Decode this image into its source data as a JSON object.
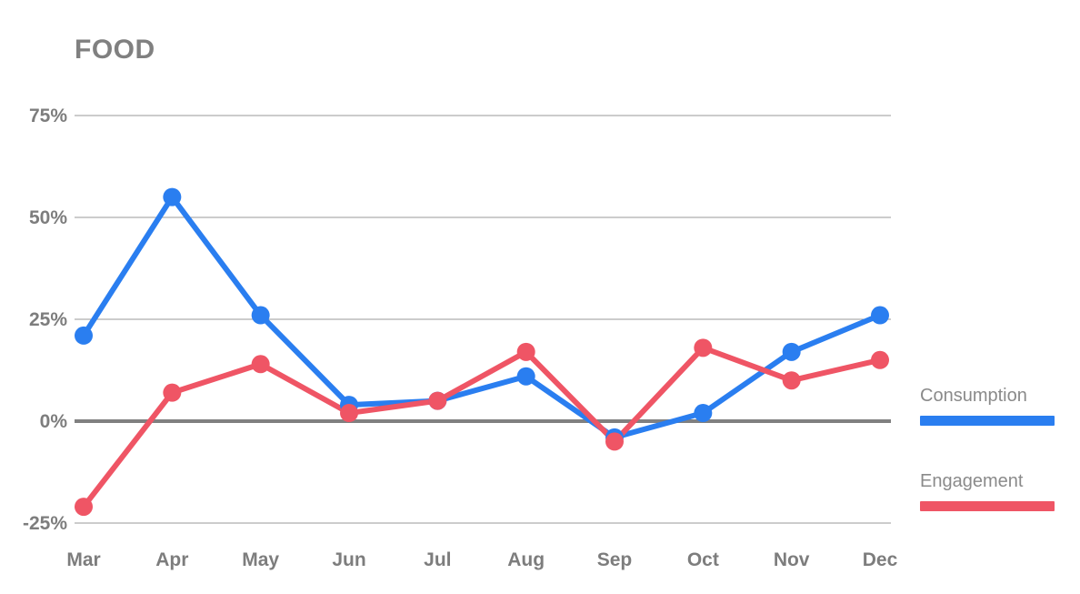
{
  "chart_data": {
    "type": "line",
    "title": "FOOD",
    "xlabel": "",
    "ylabel": "",
    "categories": [
      "Mar",
      "Apr",
      "May",
      "Jun",
      "Jul",
      "Aug",
      "Sep",
      "Oct",
      "Nov",
      "Dec"
    ],
    "series": [
      {
        "name": "Consumption",
        "color": "#2a7ef0",
        "values": [
          21,
          55,
          26,
          4,
          5,
          11,
          -4,
          2,
          17,
          26
        ]
      },
      {
        "name": "Engagement",
        "color": "#ef5565",
        "values": [
          -21,
          7,
          14,
          2,
          5,
          17,
          -5,
          18,
          10,
          15
        ]
      }
    ],
    "ylim": [
      -25,
      75
    ],
    "yticks": [
      75,
      50,
      25,
      0,
      -25
    ],
    "ytick_labels": [
      "75%",
      "50%",
      "25%",
      "0%",
      "-25%"
    ],
    "grid": true,
    "zero_line": true,
    "legend_position": "right",
    "marker": "circle"
  },
  "colors": {
    "consumption": "#2a7ef0",
    "engagement": "#ef5565",
    "gridline": "#9a9a9a",
    "zero_line": "#808080",
    "text": "#7d7d7d",
    "legend_text": "#8a8a8a",
    "background": "#ffffff"
  },
  "legend": {
    "items": [
      {
        "label": "Consumption"
      },
      {
        "label": "Engagement"
      }
    ]
  }
}
